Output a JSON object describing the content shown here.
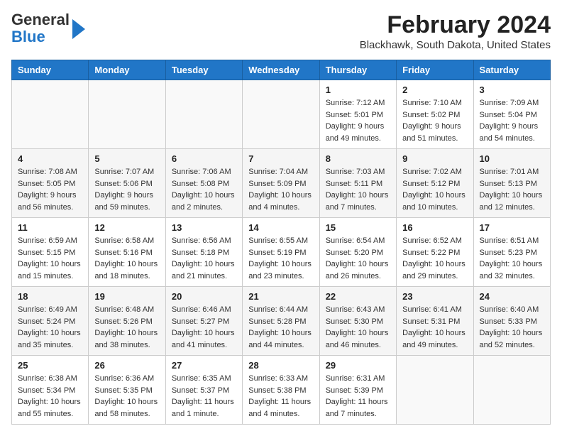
{
  "logo": {
    "general": "General",
    "blue": "Blue"
  },
  "title": "February 2024",
  "subtitle": "Blackhawk, South Dakota, United States",
  "days_of_week": [
    "Sunday",
    "Monday",
    "Tuesday",
    "Wednesday",
    "Thursday",
    "Friday",
    "Saturday"
  ],
  "weeks": [
    [
      {
        "day": "",
        "sunrise": "",
        "sunset": "",
        "daylight": ""
      },
      {
        "day": "",
        "sunrise": "",
        "sunset": "",
        "daylight": ""
      },
      {
        "day": "",
        "sunrise": "",
        "sunset": "",
        "daylight": ""
      },
      {
        "day": "",
        "sunrise": "",
        "sunset": "",
        "daylight": ""
      },
      {
        "day": "1",
        "sunrise": "Sunrise: 7:12 AM",
        "sunset": "Sunset: 5:01 PM",
        "daylight": "Daylight: 9 hours and 49 minutes."
      },
      {
        "day": "2",
        "sunrise": "Sunrise: 7:10 AM",
        "sunset": "Sunset: 5:02 PM",
        "daylight": "Daylight: 9 hours and 51 minutes."
      },
      {
        "day": "3",
        "sunrise": "Sunrise: 7:09 AM",
        "sunset": "Sunset: 5:04 PM",
        "daylight": "Daylight: 9 hours and 54 minutes."
      }
    ],
    [
      {
        "day": "4",
        "sunrise": "Sunrise: 7:08 AM",
        "sunset": "Sunset: 5:05 PM",
        "daylight": "Daylight: 9 hours and 56 minutes."
      },
      {
        "day": "5",
        "sunrise": "Sunrise: 7:07 AM",
        "sunset": "Sunset: 5:06 PM",
        "daylight": "Daylight: 9 hours and 59 minutes."
      },
      {
        "day": "6",
        "sunrise": "Sunrise: 7:06 AM",
        "sunset": "Sunset: 5:08 PM",
        "daylight": "Daylight: 10 hours and 2 minutes."
      },
      {
        "day": "7",
        "sunrise": "Sunrise: 7:04 AM",
        "sunset": "Sunset: 5:09 PM",
        "daylight": "Daylight: 10 hours and 4 minutes."
      },
      {
        "day": "8",
        "sunrise": "Sunrise: 7:03 AM",
        "sunset": "Sunset: 5:11 PM",
        "daylight": "Daylight: 10 hours and 7 minutes."
      },
      {
        "day": "9",
        "sunrise": "Sunrise: 7:02 AM",
        "sunset": "Sunset: 5:12 PM",
        "daylight": "Daylight: 10 hours and 10 minutes."
      },
      {
        "day": "10",
        "sunrise": "Sunrise: 7:01 AM",
        "sunset": "Sunset: 5:13 PM",
        "daylight": "Daylight: 10 hours and 12 minutes."
      }
    ],
    [
      {
        "day": "11",
        "sunrise": "Sunrise: 6:59 AM",
        "sunset": "Sunset: 5:15 PM",
        "daylight": "Daylight: 10 hours and 15 minutes."
      },
      {
        "day": "12",
        "sunrise": "Sunrise: 6:58 AM",
        "sunset": "Sunset: 5:16 PM",
        "daylight": "Daylight: 10 hours and 18 minutes."
      },
      {
        "day": "13",
        "sunrise": "Sunrise: 6:56 AM",
        "sunset": "Sunset: 5:18 PM",
        "daylight": "Daylight: 10 hours and 21 minutes."
      },
      {
        "day": "14",
        "sunrise": "Sunrise: 6:55 AM",
        "sunset": "Sunset: 5:19 PM",
        "daylight": "Daylight: 10 hours and 23 minutes."
      },
      {
        "day": "15",
        "sunrise": "Sunrise: 6:54 AM",
        "sunset": "Sunset: 5:20 PM",
        "daylight": "Daylight: 10 hours and 26 minutes."
      },
      {
        "day": "16",
        "sunrise": "Sunrise: 6:52 AM",
        "sunset": "Sunset: 5:22 PM",
        "daylight": "Daylight: 10 hours and 29 minutes."
      },
      {
        "day": "17",
        "sunrise": "Sunrise: 6:51 AM",
        "sunset": "Sunset: 5:23 PM",
        "daylight": "Daylight: 10 hours and 32 minutes."
      }
    ],
    [
      {
        "day": "18",
        "sunrise": "Sunrise: 6:49 AM",
        "sunset": "Sunset: 5:24 PM",
        "daylight": "Daylight: 10 hours and 35 minutes."
      },
      {
        "day": "19",
        "sunrise": "Sunrise: 6:48 AM",
        "sunset": "Sunset: 5:26 PM",
        "daylight": "Daylight: 10 hours and 38 minutes."
      },
      {
        "day": "20",
        "sunrise": "Sunrise: 6:46 AM",
        "sunset": "Sunset: 5:27 PM",
        "daylight": "Daylight: 10 hours and 41 minutes."
      },
      {
        "day": "21",
        "sunrise": "Sunrise: 6:44 AM",
        "sunset": "Sunset: 5:28 PM",
        "daylight": "Daylight: 10 hours and 44 minutes."
      },
      {
        "day": "22",
        "sunrise": "Sunrise: 6:43 AM",
        "sunset": "Sunset: 5:30 PM",
        "daylight": "Daylight: 10 hours and 46 minutes."
      },
      {
        "day": "23",
        "sunrise": "Sunrise: 6:41 AM",
        "sunset": "Sunset: 5:31 PM",
        "daylight": "Daylight: 10 hours and 49 minutes."
      },
      {
        "day": "24",
        "sunrise": "Sunrise: 6:40 AM",
        "sunset": "Sunset: 5:33 PM",
        "daylight": "Daylight: 10 hours and 52 minutes."
      }
    ],
    [
      {
        "day": "25",
        "sunrise": "Sunrise: 6:38 AM",
        "sunset": "Sunset: 5:34 PM",
        "daylight": "Daylight: 10 hours and 55 minutes."
      },
      {
        "day": "26",
        "sunrise": "Sunrise: 6:36 AM",
        "sunset": "Sunset: 5:35 PM",
        "daylight": "Daylight: 10 hours and 58 minutes."
      },
      {
        "day": "27",
        "sunrise": "Sunrise: 6:35 AM",
        "sunset": "Sunset: 5:37 PM",
        "daylight": "Daylight: 11 hours and 1 minute."
      },
      {
        "day": "28",
        "sunrise": "Sunrise: 6:33 AM",
        "sunset": "Sunset: 5:38 PM",
        "daylight": "Daylight: 11 hours and 4 minutes."
      },
      {
        "day": "29",
        "sunrise": "Sunrise: 6:31 AM",
        "sunset": "Sunset: 5:39 PM",
        "daylight": "Daylight: 11 hours and 7 minutes."
      },
      {
        "day": "",
        "sunrise": "",
        "sunset": "",
        "daylight": ""
      },
      {
        "day": "",
        "sunrise": "",
        "sunset": "",
        "daylight": ""
      }
    ]
  ]
}
